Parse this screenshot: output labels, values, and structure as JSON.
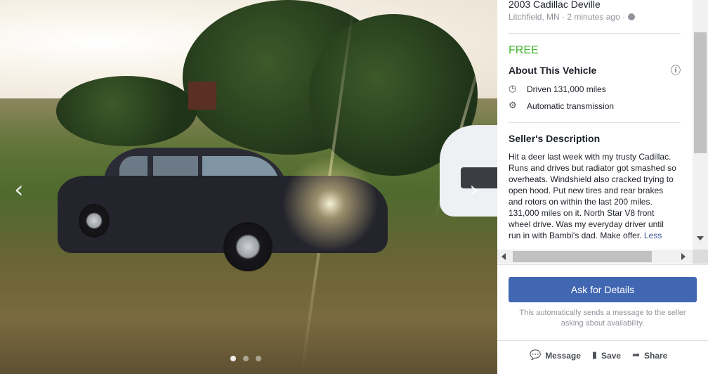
{
  "listing": {
    "title": "2003 Cadillac Deville",
    "location_time": "Litchfield, MN · 2 minutes ago ·",
    "price": "FREE"
  },
  "about": {
    "heading": "About This Vehicle",
    "specs": [
      {
        "icon": "speedometer-icon",
        "label": "Driven 131,000 miles"
      },
      {
        "icon": "engine-icon",
        "label": "Automatic transmission"
      }
    ]
  },
  "description": {
    "heading": "Seller's Description",
    "text": "Hit a deer last week with my trusty Cadillac. Runs and drives but radiator got smashed so overheats. Windshield also cracked trying to open hood. Put new tires and rear brakes and rotors on within the last 200 miles. 131,000 miles on it. North Star V8 front wheel drive. Was my everyday driver until run in with Bambi's dad. Make offer.",
    "less_link": "Less"
  },
  "cta": {
    "ask_label": "Ask for Details",
    "note": "This automatically sends a message to the seller asking about availability."
  },
  "actions": {
    "message": "Message",
    "save": "Save",
    "share": "Share"
  },
  "gallery": {
    "photo_count": 3,
    "active_index": 0
  },
  "colors": {
    "accent": "#4267b2",
    "price": "#42b72a",
    "link": "#385898"
  }
}
